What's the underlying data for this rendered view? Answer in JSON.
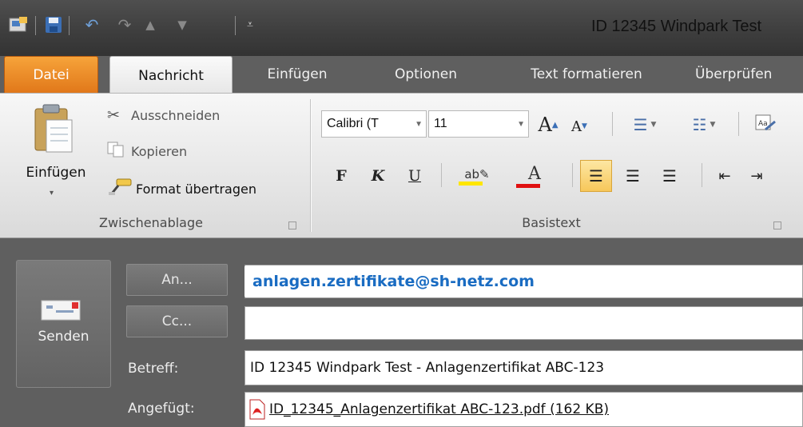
{
  "window": {
    "title": "ID 12345 Windpark Test"
  },
  "tabs": [
    {
      "label": "Datei"
    },
    {
      "label": "Nachricht"
    },
    {
      "label": "Einfügen"
    },
    {
      "label": "Optionen"
    },
    {
      "label": "Text formatieren"
    },
    {
      "label": "Überprüfen"
    }
  ],
  "clipboard": {
    "paste_label": "Einfügen",
    "cut_label": "Ausschneiden",
    "copy_label": "Kopieren",
    "format_painter_label": "Format übertragen",
    "group_label": "Zwischenablage"
  },
  "basic_text": {
    "font_name": "Calibri (T",
    "font_size": "11",
    "bold": "F",
    "italic": "K",
    "underline": "U",
    "group_label": "Basistext",
    "highlight_color": "#ffe600",
    "font_color": "#e01010"
  },
  "compose": {
    "send_label": "Senden",
    "to_button": "An...",
    "cc_button": "Cc...",
    "subject_label": "Betreff:",
    "attached_label": "Angefügt:",
    "to_value": "anlagen.zertifikate@sh-netz.com",
    "cc_value": "",
    "subject_value": "ID 12345 Windpark Test - Anlagenzertifikat ABC-123",
    "attachment_value": "ID_12345_Anlagenzertifikat ABC-123.pdf (162 KB)"
  }
}
